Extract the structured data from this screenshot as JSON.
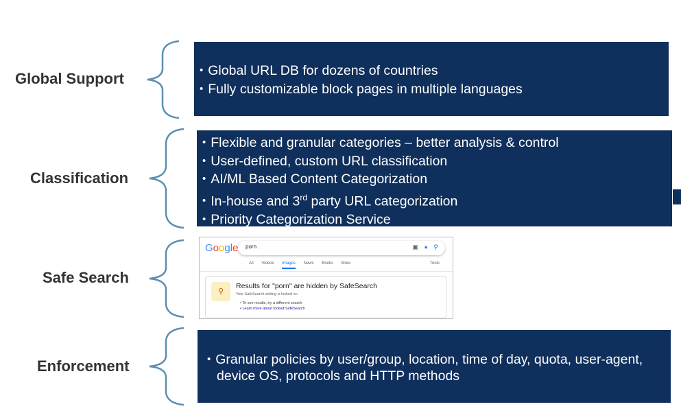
{
  "sections": [
    {
      "label": "Global Support",
      "bullets": [
        "Global URL DB for dozens of countries",
        "Fully customizable block pages in multiple languages"
      ]
    },
    {
      "label": "Classification",
      "bullets": [
        "Flexible and granular categories – better analysis & control",
        "User-defined, custom URL classification",
        "AI/ML Based Content Categorization",
        "Priority Categorization Service"
      ],
      "bullet_3rd_party": {
        "before": "In-house and 3",
        "sup": "rd",
        "after": " party URL categorization"
      }
    },
    {
      "label": "Safe Search"
    },
    {
      "label": "Enforcement",
      "bullets": [
        "Granular policies by user/group, location, time of day, quota, user-agent, device OS, protocols and HTTP methods"
      ]
    }
  ],
  "google": {
    "logo": "Google",
    "query": "porn",
    "tabs": [
      "All",
      "Videos",
      "Images",
      "News",
      "Books",
      "More"
    ],
    "active_tab": "Images",
    "tools": "Tools",
    "result_title": "Results for \"porn\" are hidden by SafeSearch",
    "result_sub": "Your SafeSearch setting is locked on",
    "bullet1": "To see results, try a different search",
    "bullet2": "Learn more about locked SafeSearch",
    "colors": {
      "accent": "#1a73e8",
      "badge_bg": "#feefc3"
    }
  },
  "colors": {
    "box": "#0f2f5c",
    "brace": "#5a8fb2",
    "label": "#333333"
  }
}
